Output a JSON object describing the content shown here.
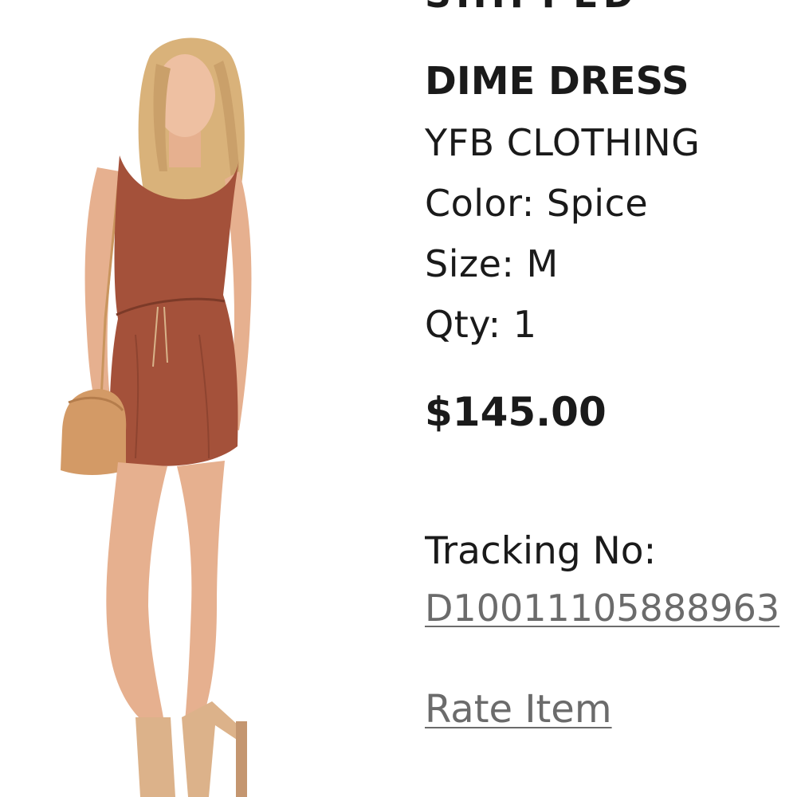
{
  "order_item": {
    "status": "SHIPPED",
    "product_name": "DIME DRESS",
    "brand": "YFB CLOTHING",
    "color": "Color: Spice",
    "size": "Size: M",
    "qty": "Qty: 1",
    "price": "$145.00",
    "tracking_label": "Tracking No:",
    "tracking_number": "D10011105888963",
    "rate_item_label": "Rate Item"
  },
  "colors": {
    "dress": "#a4513a",
    "link": "#6b6b6b",
    "text": "#1a1a1a"
  }
}
